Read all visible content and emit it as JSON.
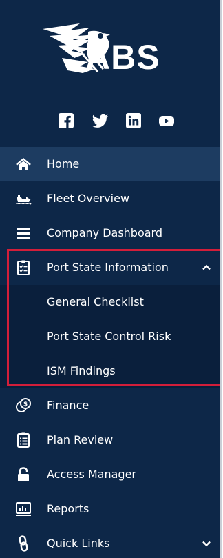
{
  "brand": {
    "name": "ABS"
  },
  "social": [
    {
      "icon": "facebook-icon"
    },
    {
      "icon": "twitter-icon"
    },
    {
      "icon": "linkedin-icon"
    },
    {
      "icon": "youtube-icon"
    }
  ],
  "colors": {
    "sidebar_bg": "#0d2748",
    "active_bg": "#1d3c61",
    "submenu_bg": "#0a1f3c",
    "highlight_border": "#d31e3a"
  },
  "menu": {
    "home": {
      "label": "Home",
      "icon": "home-icon"
    },
    "fleet_overview": {
      "label": "Fleet Overview",
      "icon": "ship-icon"
    },
    "company_dashboard": {
      "label": "Company Dashboard",
      "icon": "list-icon"
    },
    "port_state_information": {
      "label": "Port State Information",
      "icon": "checklist-icon",
      "expanded": true,
      "children": [
        {
          "label": "General Checklist"
        },
        {
          "label": "Port State Control Risk"
        },
        {
          "label": "ISM Findings"
        }
      ]
    },
    "finance": {
      "label": "Finance",
      "icon": "coins-icon"
    },
    "plan_review": {
      "label": "Plan Review",
      "icon": "clipboard-icon"
    },
    "access_manager": {
      "label": "Access Manager",
      "icon": "lock-icon"
    },
    "reports": {
      "label": "Reports",
      "icon": "chart-icon"
    },
    "quick_links": {
      "label": "Quick Links",
      "icon": "link-icon",
      "expanded": false
    }
  }
}
